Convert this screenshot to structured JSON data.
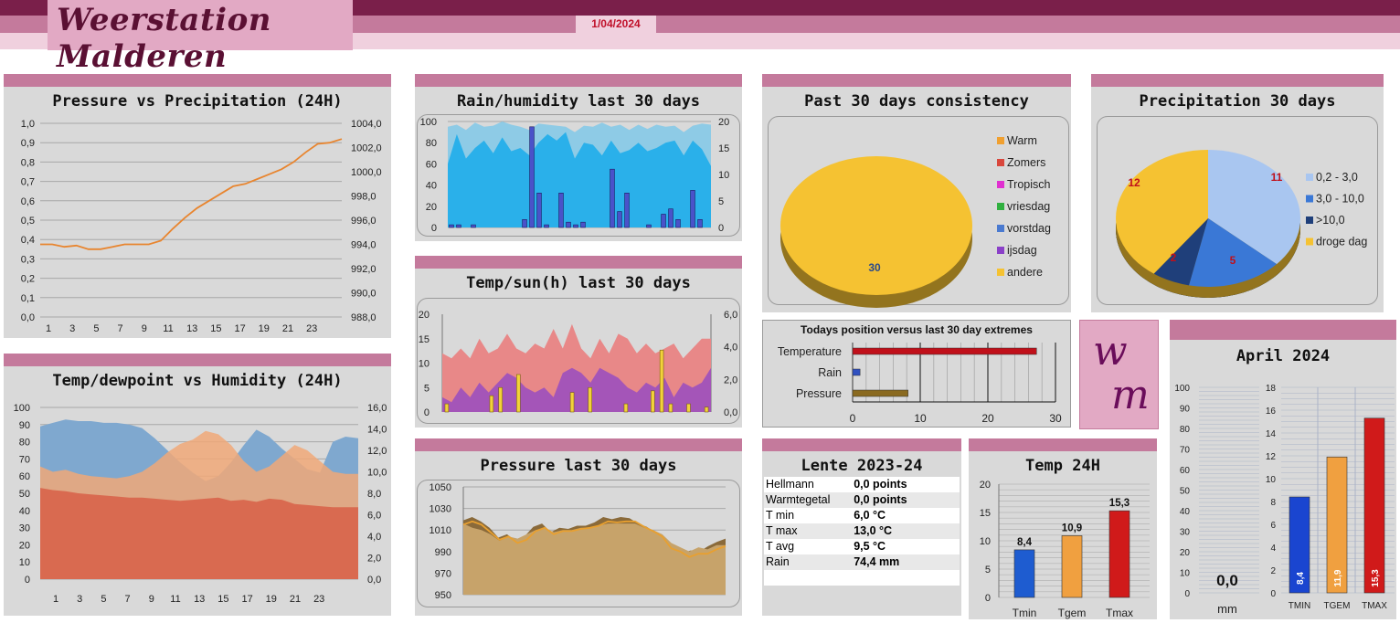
{
  "header": {
    "title": "Weerstation Malderen",
    "date": "1/04/2024",
    "logo_letters": [
      "w",
      "m"
    ]
  },
  "colors": {
    "accent": "#c47a9c",
    "dark": "#7a1f4a",
    "light": "#f0d0de"
  },
  "pressure_precip_24h": {
    "title": "Pressure vs Precipitation (24H)",
    "chart_data": {
      "type": "line",
      "x_ticks": [
        "1",
        "3",
        "5",
        "7",
        "9",
        "11",
        "13",
        "15",
        "17",
        "19",
        "21",
        "23"
      ],
      "left_ticks": [
        "1,0",
        "0,9",
        "0,8",
        "0,7",
        "0,6",
        "0,5",
        "0,4",
        "0,3",
        "0,2",
        "0,1",
        "0,0"
      ],
      "right_ticks": [
        "1004,0",
        "1002,0",
        "1000,0",
        "998,0",
        "996,0",
        "994,0",
        "992,0",
        "990,0",
        "988,0"
      ],
      "left_ylim": [
        0,
        1.0
      ],
      "right_ylim": [
        988,
        1004
      ],
      "series": [
        {
          "values": [
            994.0,
            994.0,
            993.8,
            993.9,
            993.6,
            993.6,
            993.8,
            994.0,
            994.0,
            994.0,
            994.3,
            995.3,
            996.2,
            997.0,
            997.6,
            998.2,
            998.8,
            999.0,
            999.4,
            999.8,
            1000.2,
            1000.8,
            1001.6,
            1002.3,
            1002.4,
            1002.7
          ],
          "color": "#e8852f",
          "axis": "right"
        }
      ]
    }
  },
  "temp_dew_humidity_24h": {
    "title": "Temp/dewpoint vs Humidity (24H)",
    "chart_data": {
      "type": "area",
      "x_ticks": [
        "1",
        "3",
        "5",
        "7",
        "9",
        "11",
        "13",
        "15",
        "17",
        "19",
        "21",
        "23"
      ],
      "left_ticks": [
        "100",
        "90",
        "80",
        "70",
        "60",
        "50",
        "40",
        "30",
        "20",
        "10",
        "0"
      ],
      "right_ticks": [
        "16,0",
        "14,0",
        "12,0",
        "10,0",
        "8,0",
        "6,0",
        "4,0",
        "2,0",
        "0,0"
      ],
      "left_ylim": [
        0,
        100
      ],
      "right_ylim": [
        0,
        16
      ],
      "series": [
        {
          "values": [
            89,
            91,
            93,
            92,
            92,
            91,
            91,
            90,
            88,
            82,
            75,
            68,
            62,
            57,
            60,
            68,
            78,
            87,
            83,
            76,
            70,
            64,
            62,
            80,
            83,
            82
          ],
          "color": "#7fa8cf",
          "axis": "left"
        },
        {
          "values": [
            10.5,
            10.0,
            10.2,
            9.8,
            9.6,
            9.5,
            9.4,
            9.6,
            10.0,
            10.8,
            11.8,
            12.6,
            13.0,
            13.8,
            13.5,
            12.5,
            11.0,
            10.0,
            10.5,
            11.5,
            12.5,
            12.0,
            11.0,
            10.0,
            9.8,
            9.8
          ],
          "color": "#f0a878",
          "axis": "right"
        },
        {
          "values": [
            8.5,
            8.3,
            8.2,
            8.0,
            7.9,
            7.8,
            7.7,
            7.6,
            7.6,
            7.5,
            7.4,
            7.3,
            7.4,
            7.5,
            7.6,
            7.3,
            7.4,
            7.2,
            7.5,
            7.4,
            7.0,
            6.9,
            6.8,
            6.7,
            6.7,
            6.7
          ],
          "color": "#d96a50",
          "axis": "right"
        }
      ]
    }
  },
  "rain_humidity_30d": {
    "title": "Rain/humidity last 30 days",
    "chart_data": {
      "type": "bar",
      "left_ticks": [
        "100",
        "80",
        "60",
        "40",
        "20",
        "0"
      ],
      "right_ticks": [
        "20",
        "15",
        "10",
        "5",
        "0"
      ],
      "left_ylim": [
        0,
        100
      ],
      "right_ylim": [
        0,
        20
      ],
      "series": [
        {
          "values": [
            95,
            97,
            92,
            99,
            95,
            96,
            100,
            97,
            95,
            92,
            98,
            97,
            96,
            95,
            90,
            96,
            95,
            99,
            95,
            97,
            92,
            97,
            93,
            97,
            95,
            96,
            90,
            96,
            98,
            97
          ],
          "color": "#8ecbe6",
          "axis": "left"
        },
        {
          "values": [
            60,
            88,
            65,
            75,
            82,
            70,
            85,
            72,
            75,
            68,
            80,
            88,
            82,
            90,
            65,
            80,
            78,
            68,
            82,
            70,
            73,
            80,
            72,
            75,
            80,
            82,
            68,
            82,
            74,
            58
          ],
          "color": "#2ab0ea",
          "axis": "left"
        },
        {
          "values": [
            0.5,
            0.5,
            0,
            0.5,
            0,
            0,
            0,
            0,
            0,
            0,
            1.5,
            19,
            6.5,
            0.5,
            0,
            6.5,
            1,
            0.5,
            1,
            0,
            0,
            0,
            11,
            3,
            6.5,
            0,
            0,
            0.5,
            0,
            2.5,
            3.5,
            1.5,
            0,
            7,
            1.5,
            0
          ],
          "color": "#4a52c9",
          "axis": "right"
        }
      ]
    }
  },
  "temp_sun_30d": {
    "title": "Temp/sun(h) last 30 days",
    "chart_data": {
      "type": "area",
      "left_ticks": [
        "20",
        "15",
        "10",
        "5",
        "0"
      ],
      "right_ticks": [
        "6,0",
        "4,0",
        "2,0",
        "0,0"
      ],
      "left_ylim": [
        0,
        20
      ],
      "right_ylim": [
        0,
        6
      ],
      "series": [
        {
          "values": [
            12,
            11,
            13,
            11,
            15,
            12,
            13,
            16,
            13,
            12,
            14,
            13,
            17,
            13,
            18,
            13,
            11,
            15,
            12,
            16,
            15,
            12,
            14,
            12,
            13,
            14,
            11,
            13,
            15,
            15
          ],
          "color": "#e88888",
          "axis": "left"
        },
        {
          "values": [
            3,
            2,
            5,
            3,
            6,
            4,
            6,
            8,
            7,
            5,
            4,
            5,
            3,
            8,
            9,
            8,
            6,
            9,
            8,
            7,
            5,
            4,
            6,
            5,
            7,
            3,
            6,
            5,
            6,
            9
          ],
          "color": "#a455b8",
          "axis": "left"
        },
        {
          "values": [
            0.5,
            0,
            0,
            0,
            0,
            1,
            1.5,
            0,
            2.3,
            0,
            0,
            0,
            0,
            0,
            1.2,
            0,
            1.5,
            0,
            0,
            0,
            0.5,
            0,
            0,
            1.3,
            3.8,
            0.5,
            0,
            0.5,
            0,
            0.3
          ],
          "color": "#f2d23a",
          "axis": "right"
        }
      ]
    }
  },
  "pressure_30d": {
    "title": "Pressure last 30 days",
    "chart_data": {
      "type": "area",
      "y_ticks": [
        "1050",
        "1030",
        "1010",
        "990",
        "970",
        "950"
      ],
      "ylim": [
        950,
        1050
      ],
      "series": [
        {
          "values": [
            1019,
            1022,
            1018,
            1012,
            1003,
            1006,
            1000,
            1004,
            1013,
            1016,
            1008,
            1012,
            1011,
            1014,
            1014,
            1017,
            1022,
            1020,
            1022,
            1021,
            1016,
            1013,
            1007,
            995,
            993,
            988,
            991,
            990,
            995,
            999,
            1002
          ],
          "color": "#8a6a3a"
        },
        {
          "values": [
            1016,
            1012,
            1010,
            1006,
            1000,
            1004,
            1002,
            1006,
            1010,
            1012,
            1008,
            1010,
            1010,
            1012,
            1012,
            1014,
            1016,
            1016,
            1016,
            1016,
            1012,
            1010,
            1006,
            998,
            994,
            990,
            994,
            992,
            996,
            996
          ],
          "color": "#c7a36a"
        },
        {
          "values": [
            1015,
            1018,
            1015,
            1008,
            1001,
            1004,
            998,
            1001,
            1009,
            1012,
            1006,
            1009,
            1009,
            1011,
            1012,
            1014,
            1018,
            1017,
            1018,
            1018,
            1013,
            1009,
            1004,
            993,
            990,
            985,
            988,
            988,
            992,
            995
          ],
          "color": "#e8a030"
        }
      ]
    }
  },
  "consistency_30d": {
    "title": "Past 30 days consistency",
    "chart_data": {
      "type": "pie",
      "categories": [
        "Warm",
        "Zomers",
        "Tropisch",
        "vriesdag",
        "vorstdag",
        "ijsdag",
        "andere"
      ],
      "values": [
        0,
        0,
        0,
        0,
        0,
        0,
        30
      ],
      "colors": [
        "#f0a030",
        "#d9473c",
        "#e030d0",
        "#30b040",
        "#4a7ad0",
        "#8a40c8",
        "#f5c232"
      ],
      "data_labels": [
        "30"
      ]
    }
  },
  "precip_30d": {
    "title": "Precipitation 30 days",
    "chart_data": {
      "type": "pie",
      "categories": [
        "0,2 - 3,0",
        "3,0 - 10,0",
        ">10,0",
        "droge dag"
      ],
      "values": [
        11,
        5,
        2,
        12
      ],
      "colors": [
        "#a9c6f0",
        "#3a78d6",
        "#1f3f7a",
        "#f5c232"
      ],
      "data_labels": [
        "11",
        "5",
        "2",
        "12"
      ]
    }
  },
  "todays_position": {
    "title": "Todays position versus last 30 day extremes",
    "chart_data": {
      "type": "bar",
      "categories": [
        "Temperature",
        "Rain",
        "Pressure"
      ],
      "values": [
        27.2,
        1.1,
        8.2
      ],
      "colors": [
        "#c0101a",
        "#3050c0",
        "#8a6a20"
      ],
      "x_ticks": [
        "0",
        "10",
        "20",
        "30"
      ],
      "xlim": [
        0,
        30
      ]
    }
  },
  "lente": {
    "title": "Lente 2023-24",
    "rows": [
      {
        "name": "Hellmann",
        "value": "0,0 points"
      },
      {
        "name": "Warmtegetal",
        "value": "0,0 points"
      },
      {
        "name": "T min",
        "value": "6,0 °C"
      },
      {
        "name": "T max",
        "value": "13,0 °C"
      },
      {
        "name": "T avg",
        "value": "9,5 °C"
      },
      {
        "name": "Rain",
        "value": "74,4 mm"
      }
    ]
  },
  "temp_24h": {
    "title": "Temp 24H",
    "chart_data": {
      "type": "bar",
      "categories": [
        "Tmin",
        "Tgem",
        "Tmax"
      ],
      "values": [
        8.4,
        10.9,
        15.3
      ],
      "data_labels": [
        "8,4",
        "10,9",
        "15,3"
      ],
      "colors": [
        "#1e5cd0",
        "#f0a040",
        "#d01a1a"
      ],
      "y_ticks": [
        "20",
        "15",
        "10",
        "5",
        "0"
      ],
      "ylim": [
        0,
        20
      ]
    }
  },
  "april": {
    "title": "April 2024",
    "rain_label": "mm",
    "rain_value": "0,0",
    "chart_data": {
      "type": "bar",
      "left_ticks": [
        "100",
        "90",
        "80",
        "70",
        "60",
        "50",
        "40",
        "30",
        "20",
        "10",
        "0"
      ],
      "right_ticks": [
        "18",
        "16",
        "14",
        "12",
        "10",
        "8",
        "6",
        "4",
        "2",
        "0"
      ],
      "left_ylim": [
        0,
        100
      ],
      "right_ylim": [
        0,
        18
      ],
      "categories": [
        "TMIN",
        "TGEM",
        "TMAX"
      ],
      "values": [
        8.4,
        11.9,
        15.3
      ],
      "data_labels": [
        "8,4",
        "11,9",
        "15,3"
      ],
      "colors": [
        "#1a45d0",
        "#f0a040",
        "#d01a1a"
      ]
    }
  }
}
